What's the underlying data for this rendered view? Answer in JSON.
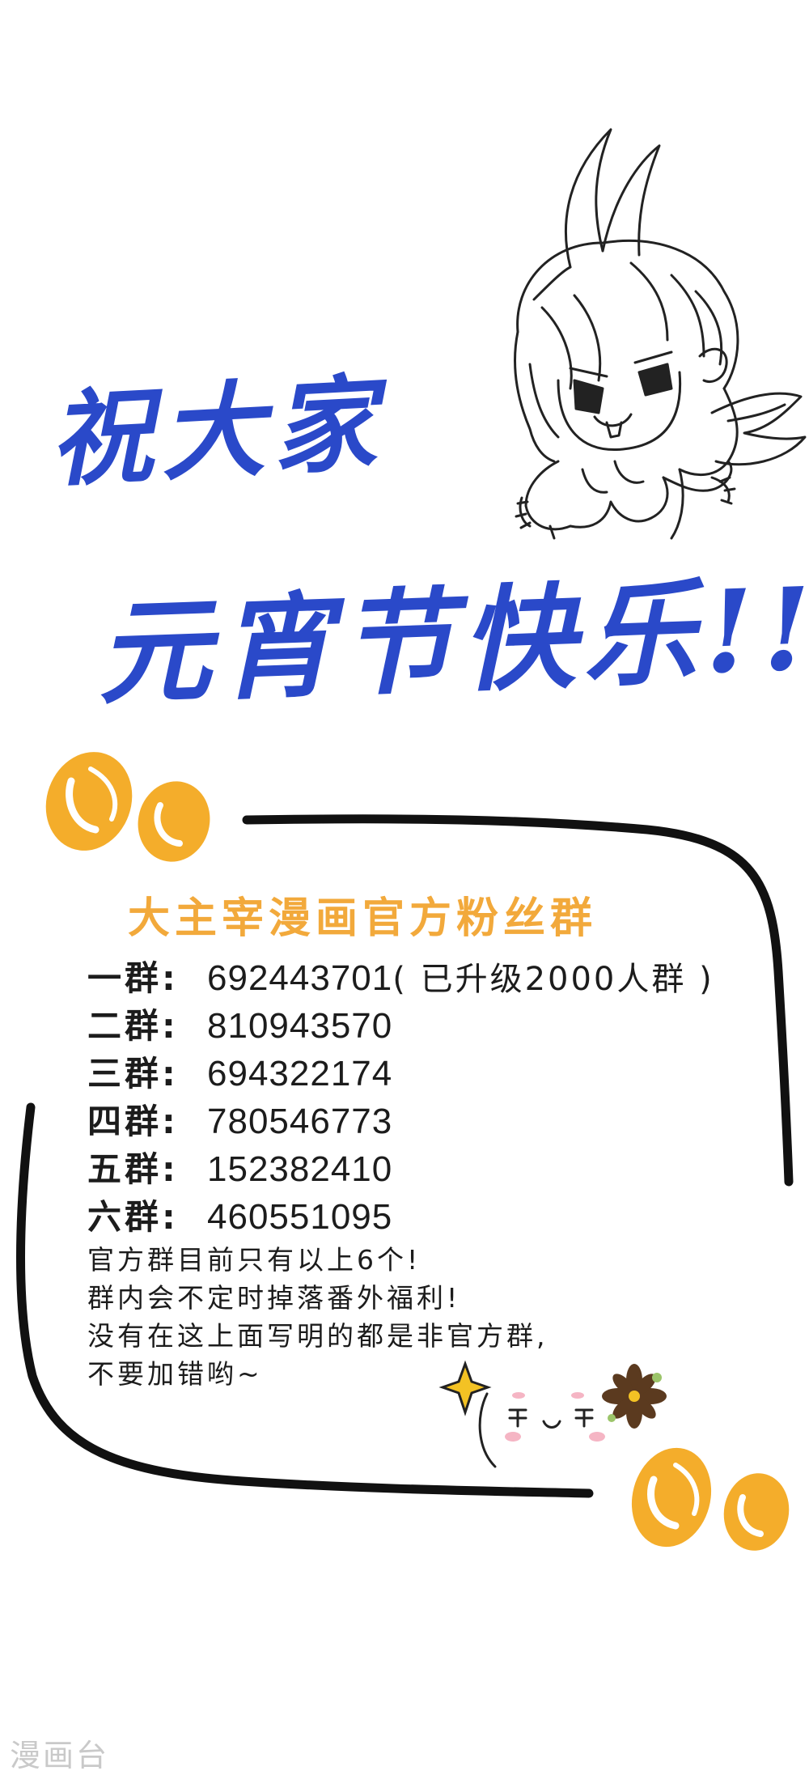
{
  "banner": {
    "line1": "祝大家",
    "line2": "元宵节快乐!!"
  },
  "fan_groups": {
    "title": "大主宰漫画官方粉丝群",
    "groups": [
      {
        "label": "一群:",
        "number": "692443701",
        "note": "( 已升级2000人群 )"
      },
      {
        "label": "二群:",
        "number": "810943570",
        "note": ""
      },
      {
        "label": "三群:",
        "number": "694322174",
        "note": ""
      },
      {
        "label": "四群:",
        "number": "780546773",
        "note": ""
      },
      {
        "label": "五群:",
        "number": "152382410",
        "note": ""
      },
      {
        "label": "六群:",
        "number": "460551095",
        "note": ""
      }
    ],
    "notes": [
      "官方群目前只有以上6个!",
      "群内会不定时掉落番外福利!",
      "没有在这上面写明的都是非官方群,",
      "不要加错哟~"
    ]
  },
  "watermark": "漫画台",
  "colors": {
    "title_blue": "#2a49c9",
    "accent_orange": "#f2a93b",
    "ink": "#1c1c1c"
  }
}
